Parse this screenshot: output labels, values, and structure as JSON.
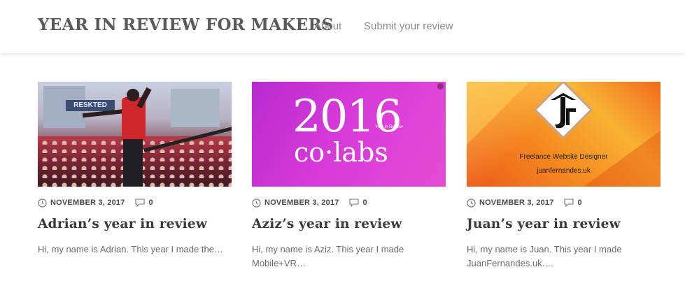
{
  "header": {
    "site_title": "YEAR IN REVIEW FOR MAKERS",
    "nav": [
      {
        "label": "About"
      },
      {
        "label": "Submit your review"
      }
    ]
  },
  "posts": [
    {
      "date": "NOVEMBER 3, 2017",
      "comments": "0",
      "title": "Adrian’s year in review",
      "excerpt": "Hi, my name is Adrian. This year I made the…",
      "thumbnail": {
        "sign_text": "RESKTED"
      }
    },
    {
      "date": "NOVEMBER 3, 2017",
      "comments": "0",
      "title": "Aziz’s year in review",
      "excerpt_line1": "Hi, my name is Aziz. This year I made",
      "excerpt_line2": "Mobile+VR…",
      "thumbnail": {
        "year": "2016",
        "brand": "co·labs",
        "small_text": "Year in Review"
      }
    },
    {
      "date": "NOVEMBER 3, 2017",
      "comments": "0",
      "title": "Juan’s year in review",
      "excerpt_line1": "Hi, my name is Juan. This year I made",
      "excerpt_line2": "JuanFernandes.uk.…",
      "thumbnail": {
        "tagline": "Freelance Website Designer",
        "domain": "juanfernandes.uk"
      }
    }
  ],
  "icons": {
    "date": "clock-icon",
    "comments": "comment-icon"
  },
  "colors": {
    "thumb2": "#d63ad8",
    "thumb3": "#f58a1f",
    "title": "#3a3a3a",
    "meta": "#4a4a4a"
  }
}
